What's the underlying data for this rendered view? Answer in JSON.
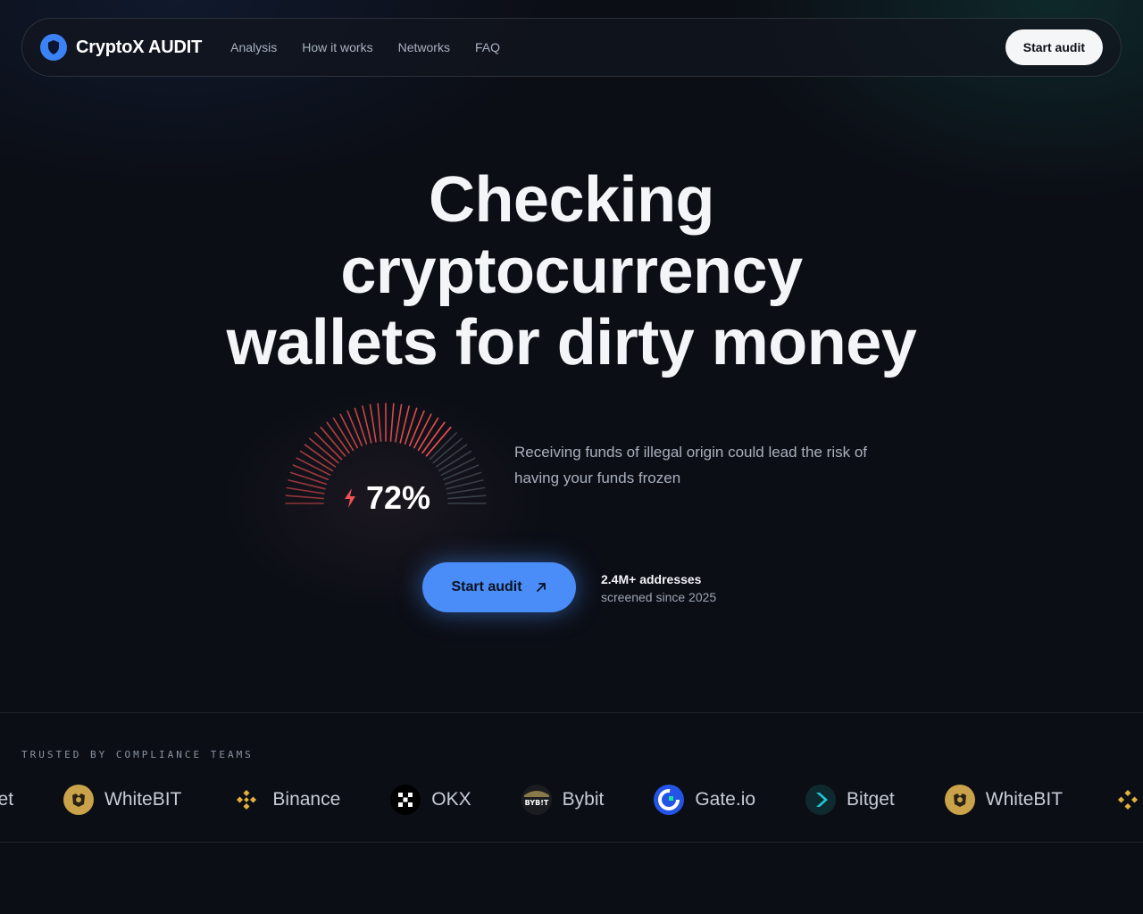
{
  "nav": {
    "brand": "CryptoX AUDIT",
    "links": [
      "Analysis",
      "How it works",
      "Networks",
      "FAQ"
    ],
    "cta": "Start audit"
  },
  "hero": {
    "title_lines": [
      "Checking",
      "cryptocurrency",
      "wallets for dirty money"
    ],
    "gauge_value": 72,
    "gauge_label": "72%",
    "description": "Receiving funds of illegal origin could lead the risk of having your funds frozen",
    "cta": "Start audit",
    "stats_main": "2.4M+ addresses",
    "stats_sub": "screened since 2025"
  },
  "trust": {
    "label": "TRUSTED BY COMPLIANCE TEAMS",
    "exchanges": [
      {
        "name": "tget",
        "icon": "bitget-icon"
      },
      {
        "name": "WhiteBIT",
        "icon": "whitebit-icon"
      },
      {
        "name": "Binance",
        "icon": "binance-icon"
      },
      {
        "name": "OKX",
        "icon": "okx-icon"
      },
      {
        "name": "Bybit",
        "icon": "bybit-icon"
      },
      {
        "name": "Gate.io",
        "icon": "gateio-icon"
      },
      {
        "name": "Bitget",
        "icon": "bitget-icon"
      },
      {
        "name": "WhiteBIT",
        "icon": "whitebit-icon"
      }
    ]
  },
  "colors": {
    "accent": "#4a8df8",
    "gauge_active": "#f05252",
    "gauge_inactive": "#3a3f48"
  }
}
